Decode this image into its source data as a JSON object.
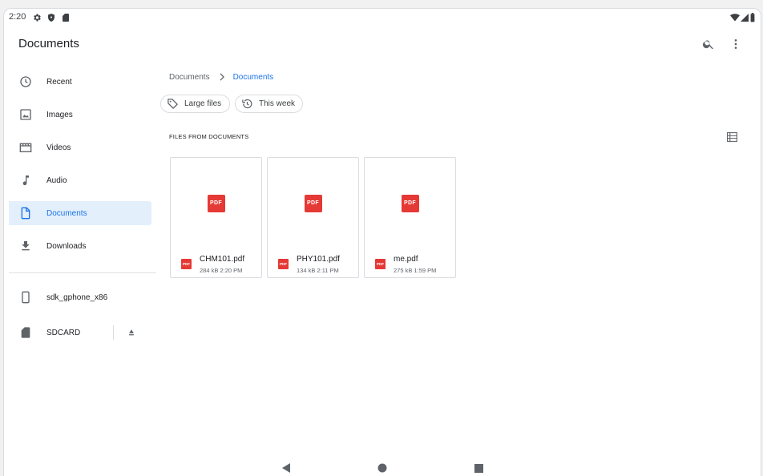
{
  "status_bar": {
    "time": "2:20",
    "left_icons": [
      "settings-icon",
      "shield-icon",
      "sdcard-icon"
    ],
    "right_icons": [
      "wifi-icon",
      "signal-icon",
      "battery-icon"
    ]
  },
  "app_bar": {
    "title": "Documents",
    "actions": [
      "search-icon",
      "more-vert-icon"
    ]
  },
  "sidebar": {
    "items": [
      {
        "label": "Recent",
        "icon": "clock-icon",
        "active": false
      },
      {
        "label": "Images",
        "icon": "image-icon",
        "active": false
      },
      {
        "label": "Videos",
        "icon": "video-icon",
        "active": false
      },
      {
        "label": "Audio",
        "icon": "music-note-icon",
        "active": false
      },
      {
        "label": "Documents",
        "icon": "document-icon",
        "active": true
      },
      {
        "label": "Downloads",
        "icon": "download-icon",
        "active": false
      }
    ],
    "devices": [
      {
        "label": "sdk_gphone_x86",
        "icon": "phone-icon"
      },
      {
        "label": "SDCARD",
        "icon": "sdcard-icon",
        "action_icon": "eject-icon"
      }
    ]
  },
  "breadcrumb": {
    "items": [
      "Documents",
      "Documents"
    ]
  },
  "chips": [
    {
      "label": "Large files",
      "icon": "tag-icon"
    },
    {
      "label": "This week",
      "icon": "history-icon"
    }
  ],
  "section": {
    "title": "FILES FROM DOCUMENTS",
    "view_icon": "list-view-icon"
  },
  "files": [
    {
      "name": "CHM101.pdf",
      "meta": "284 kB 2:20 PM",
      "badge": "PDF"
    },
    {
      "name": "PHY101.pdf",
      "meta": "134 kB 2:11 PM",
      "badge": "PDF"
    },
    {
      "name": "me.pdf",
      "meta": "275 kB 1:59 PM",
      "badge": "PDF"
    }
  ],
  "nav_bar": [
    "back-icon",
    "home-icon",
    "recents-icon"
  ],
  "colors": {
    "accent": "#1a73e8",
    "active_bg": "#e3effb",
    "pdf_red": "#e53935",
    "text": "#202124",
    "secondary_text": "#5f6368"
  }
}
